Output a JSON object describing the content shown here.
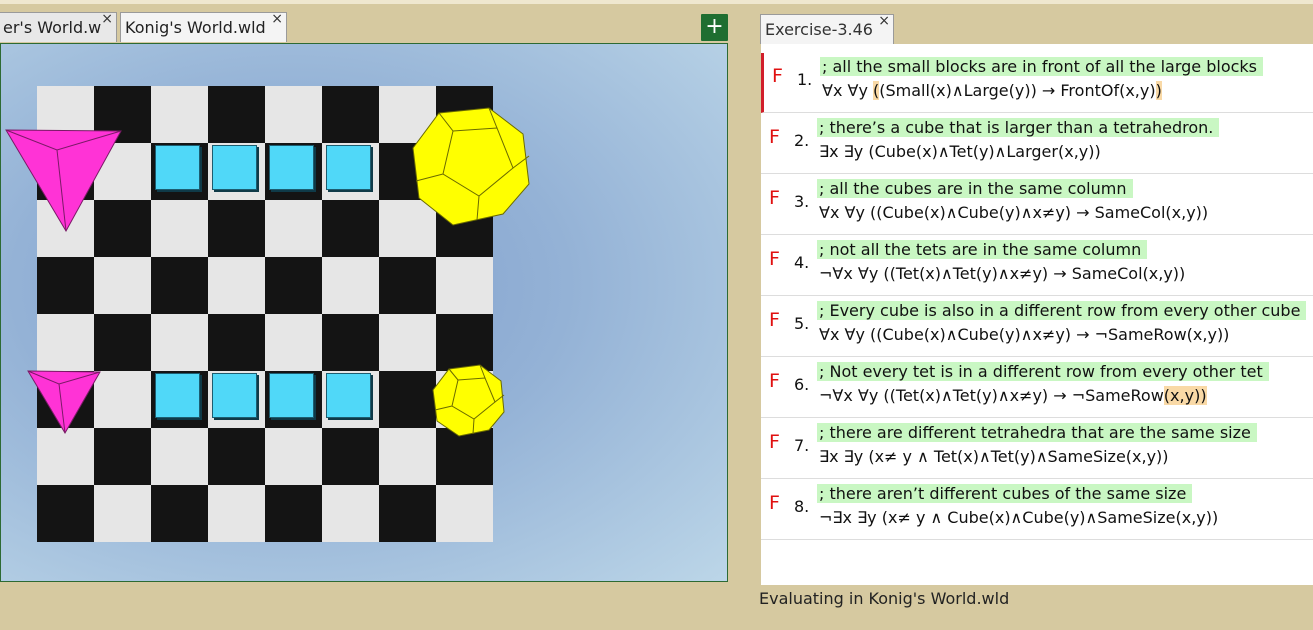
{
  "left": {
    "tabs": [
      {
        "label": "er's World.w",
        "close": "×"
      },
      {
        "label": "Konig's World.wld",
        "close": "×"
      }
    ],
    "add_button": "+",
    "world": {
      "board": {
        "rows": 8,
        "cols": 8
      },
      "cubes": [
        {
          "row": 1,
          "col": 2
        },
        {
          "row": 1,
          "col": 3
        },
        {
          "row": 1,
          "col": 4
        },
        {
          "row": 1,
          "col": 5
        },
        {
          "row": 5,
          "col": 2
        },
        {
          "row": 5,
          "col": 3
        },
        {
          "row": 5,
          "col": 4
        },
        {
          "row": 5,
          "col": 5
        }
      ],
      "colors": {
        "cube": "#50d8f8",
        "tet": "#ff33d6",
        "dodec": "#ffff00",
        "dark_square": "#141414",
        "light_square": "#e6e6e6"
      }
    }
  },
  "right": {
    "tab": {
      "label": "Exercise-3.46",
      "close": "×"
    },
    "sentences": [
      {
        "verdict": "F",
        "number": "1.",
        "comment": "; all the small blocks are in front of all the large blocks",
        "formula_parts": [
          "∀x ∀y ",
          "(",
          "(Small(x)∧Large(y)) → FrontOf(x,y)",
          ")"
        ]
      },
      {
        "verdict": "F",
        "number": "2.",
        "comment": "; there’s a cube that is larger than a tetrahedron.",
        "formula_parts": [
          "∃x ∃y (Cube(x)∧Tet(y)∧Larger(x,y))"
        ]
      },
      {
        "verdict": "F",
        "number": "3.",
        "comment": "; all the cubes are in the same column",
        "formula_parts": [
          "∀x ∀y ((Cube(x)∧Cube(y)∧x≠y) → SameCol(x,y))"
        ]
      },
      {
        "verdict": "F",
        "number": "4.",
        "comment": "; not all the tets are in the same column",
        "formula_parts": [
          "¬∀x ∀y ((Tet(x)∧Tet(y)∧x≠y) → SameCol(x,y))"
        ]
      },
      {
        "verdict": "F",
        "number": "5.",
        "comment": "; Every cube is also in a different row from every other cube",
        "formula_parts": [
          "∀x ∀y ((Cube(x)∧Cube(y)∧x≠y) → ¬SameRow(x,y))"
        ]
      },
      {
        "verdict": "F",
        "number": "6.",
        "comment": "; Not every tet is in a different row from every other tet",
        "formula_parts": [
          "¬∀x ∀y ((Tet(x)∧Tet(y)∧x≠y) → ¬SameRow",
          "(",
          "x,y",
          ")",
          ")"
        ]
      },
      {
        "verdict": "F",
        "number": "7.",
        "comment": "; there are different tetrahedra that are the same size",
        "formula_parts": [
          "∃x ∃y (x≠ y ∧ Tet(x)∧Tet(y)∧SameSize(x,y))"
        ]
      },
      {
        "verdict": "F",
        "number": "8.",
        "comment": "; there aren’t different cubes of the same size",
        "formula_parts": [
          "¬∃x ∃y (x≠ y ∧ Cube(x)∧Cube(y)∧SameSize(x,y))"
        ]
      }
    ],
    "status": "Evaluating in Konig's World.wld"
  }
}
